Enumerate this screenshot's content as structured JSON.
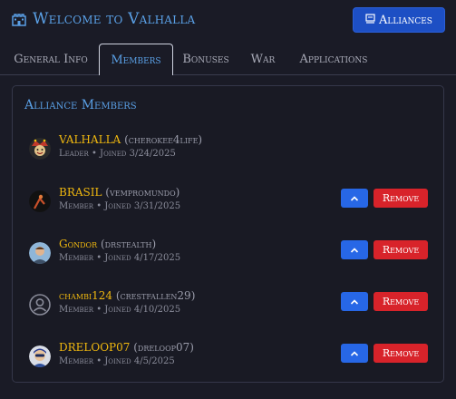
{
  "header": {
    "title": "Welcome to Valhalla",
    "alliances_label": "Alliances"
  },
  "tabs": [
    {
      "label": "General Info"
    },
    {
      "label": "Members",
      "active": true
    },
    {
      "label": "Bonuses"
    },
    {
      "label": "War"
    },
    {
      "label": "Applications"
    }
  ],
  "members_card": {
    "title": "Alliance Members"
  },
  "members": [
    {
      "name": "VALHALLA",
      "username": "(cherokee4life)",
      "meta": "Leader • Joined 3/24/2025",
      "avatar": "jester-avatar",
      "actions": false
    },
    {
      "name": "BRASIL",
      "username": "(vempromundo)",
      "meta": "Member • Joined 3/31/2025",
      "avatar": "dark-figure-avatar",
      "actions": true
    },
    {
      "name": "Gondor",
      "username": "(drstealth)",
      "meta": "Member • Joined 4/17/2025",
      "avatar": "person-avatar",
      "actions": true
    },
    {
      "name": "chambi124",
      "username": "(crestfallen29)",
      "meta": "Member • Joined 4/10/2025",
      "avatar": "default-user-avatar",
      "actions": true
    },
    {
      "name": "DRELOOP07",
      "username": "(dreloop07)",
      "meta": "Member • Joined 4/5/2025",
      "avatar": "photo-avatar",
      "actions": true
    }
  ],
  "actions": {
    "remove_label": "Remove",
    "promote_icon": "chevron-up-icon"
  },
  "colors": {
    "accent": "#5aa0e6",
    "gold": "#f0b80f",
    "primary_button": "#1d4fc4",
    "danger": "#d8232a"
  }
}
